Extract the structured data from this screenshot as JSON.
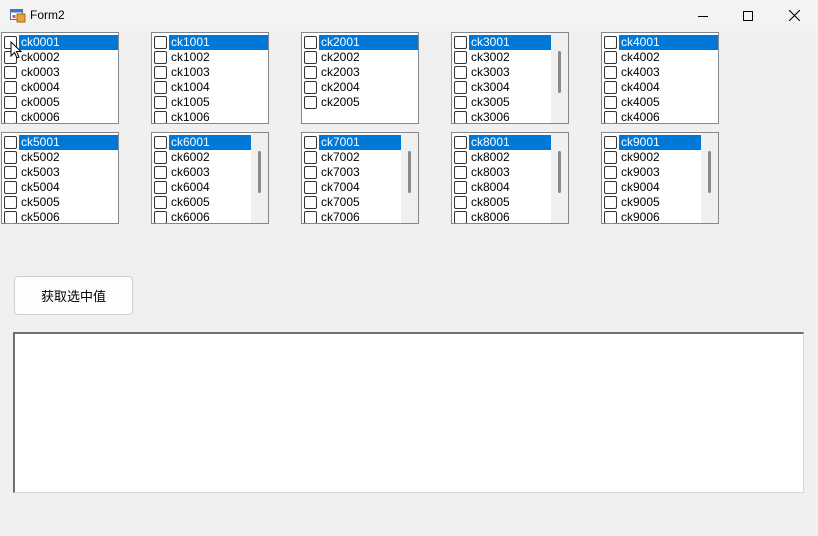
{
  "window": {
    "title": "Form2"
  },
  "icons": {
    "app": "form-app-icon",
    "minimize": "minimize-icon",
    "maximize": "maximize-icon",
    "close": "close-icon",
    "cursor": "mouse-cursor-icon"
  },
  "colors": {
    "selection": "#0078d7",
    "background": "#f0f0f0"
  },
  "lists": [
    {
      "items": [
        "ck0001",
        "ck0002",
        "ck0003",
        "ck0004",
        "ck0005",
        "ck0006"
      ],
      "scroll": false
    },
    {
      "items": [
        "ck1001",
        "ck1002",
        "ck1003",
        "ck1004",
        "ck1005",
        "ck1006"
      ],
      "scroll": false
    },
    {
      "items": [
        "ck2001",
        "ck2002",
        "ck2003",
        "ck2004",
        "ck2005"
      ],
      "scroll": false
    },
    {
      "items": [
        "ck3001",
        "ck3002",
        "ck3003",
        "ck3004",
        "ck3005",
        "ck3006"
      ],
      "scroll": true
    },
    {
      "items": [
        "ck4001",
        "ck4002",
        "ck4003",
        "ck4004",
        "ck4005",
        "ck4006"
      ],
      "scroll": false
    },
    {
      "items": [
        "ck5001",
        "ck5002",
        "ck5003",
        "ck5004",
        "ck5005",
        "ck5006"
      ],
      "scroll": false
    },
    {
      "items": [
        "ck6001",
        "ck6002",
        "ck6003",
        "ck6004",
        "ck6005",
        "ck6006"
      ],
      "scroll": true
    },
    {
      "items": [
        "ck7001",
        "ck7002",
        "ck7003",
        "ck7004",
        "ck7005",
        "ck7006"
      ],
      "scroll": true
    },
    {
      "items": [
        "ck8001",
        "ck8002",
        "ck8003",
        "ck8004",
        "ck8005",
        "ck8006"
      ],
      "scroll": true
    },
    {
      "items": [
        "ck9001",
        "ck9002",
        "ck9003",
        "ck9004",
        "ck9005",
        "ck9006"
      ],
      "scroll": true
    }
  ],
  "button": {
    "label": "获取选中值"
  },
  "output": {
    "value": ""
  }
}
